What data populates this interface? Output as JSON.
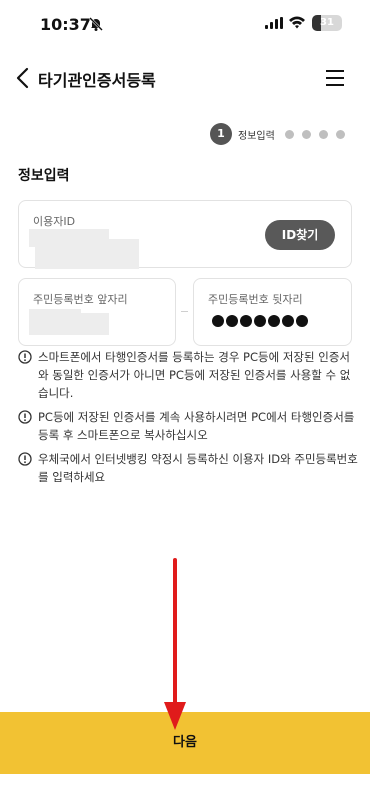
{
  "status_bar": {
    "time": "10:37",
    "battery": "31"
  },
  "header": {
    "title": "타기관인증서등록"
  },
  "steps": {
    "current_number": "1",
    "current_label": "정보입력"
  },
  "section": {
    "title": "정보입력"
  },
  "form": {
    "user_id_label": "이용자ID",
    "id_lookup_button": "ID찾기",
    "ssn_front_label": "주민등록번호 앞자리",
    "ssn_back_label": "주민등록번호 뒷자리"
  },
  "notices": [
    "스마트폰에서 타행인증서를 등록하는 경우 PC등에 저장된 인증서와 동일한 인증서가 아니면 PC등에 저장된 인증서를 사용할 수 없습니다.",
    "PC등에 저장된 인증서를 계속 사용하시려면 PC에서 타행인증서를 등록 후 스마트폰으로 복사하십시오",
    "우체국에서 인터넷뱅킹 약정시 등록하신 이용자 ID와 주민등록번호를 입력하세요"
  ],
  "footer": {
    "next_button": "다음"
  },
  "colors": {
    "accent": "#f2c233",
    "annotation": "#e01b1b"
  }
}
